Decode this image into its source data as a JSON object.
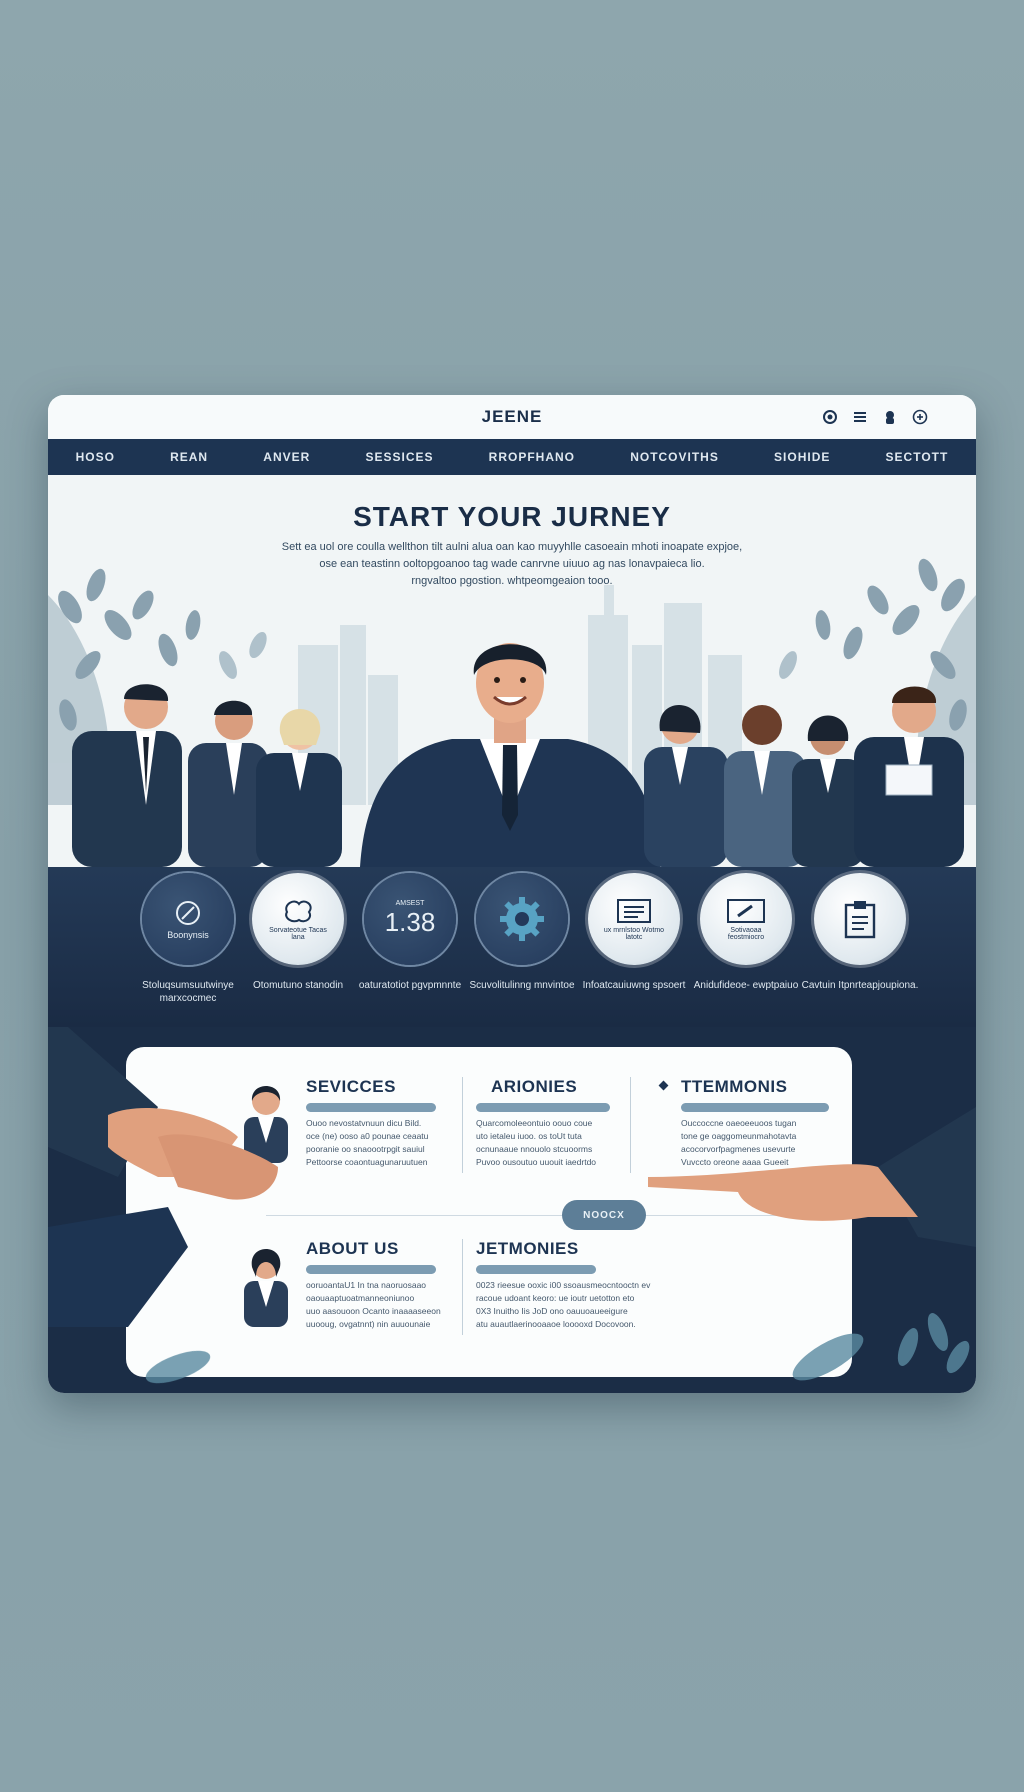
{
  "window": {
    "brand": "JEENE",
    "controls": [
      "record-icon",
      "menu-icon",
      "user-icon",
      "add-icon"
    ]
  },
  "nav": [
    "HOSO",
    "REAN",
    "ANVER",
    "SESSICES",
    "RROPFHANO",
    "NOTCOVITHS",
    "SIOHIDE",
    "SECTOTT"
  ],
  "hero": {
    "title": "START YOUR JURNEY",
    "subtitle_lines": [
      "Sett ea uol ore coulla wellthon tilt aulni alua oan kao muyyhlle casoeain mhoti inoapate expjoe,",
      "ose ean teastinn ooltopgoanoo tag wade canrvne uiuuo ag nas lonavpaieca lio.",
      "rngvaltoo pgostion.            whtpeomgeaion tooo."
    ]
  },
  "features": [
    {
      "icon": "leaf-icon",
      "circle_text": "Boonynsis",
      "label": "Stoluqsumsuutwinye marxcocmec"
    },
    {
      "icon": "brain-icon",
      "circle_text": "Sorvateotue Tacas lana",
      "label": "Otomutuno stanodin"
    },
    {
      "icon": "counter-icon",
      "circle_small": "AMSEST",
      "circle_text": "1.38",
      "label": "oaturatotiot pgvpmnnte"
    },
    {
      "icon": "gear-icon",
      "circle_text": "",
      "label": "Scuvolitulinng mnvintoe"
    },
    {
      "icon": "document-icon",
      "circle_text": "ux mrnlstoo Wotmo latotc",
      "label": "Infoatcauiuwng spsoert"
    },
    {
      "icon": "edit-icon",
      "circle_text": "Sotivaoaa feostmiocro",
      "label": "Anidufideoe- ewptpaiuo"
    },
    {
      "icon": "clipboard-icon",
      "circle_text": "",
      "label": "Cavtuin Itpnrteapjoupiona."
    }
  ],
  "sections": [
    {
      "name": "services",
      "title": "SEVICCES",
      "lines": [
        "Ouoo nevostatvnuun dicu Bild.",
        "oce (ne) ooso a0 pounae ceaatu",
        "pooranie oo snaoootrpgit sauiul",
        "Pettoorse coaontuagunaruutuen"
      ]
    },
    {
      "name": "arionies",
      "title": "ARIONIES",
      "lines": [
        "Quarcomoleeontuio oouo coue",
        "uto ietaleu iuoo. os toUt tuta",
        "ocnunaaue nnouolo stcuoorms",
        "Puvoo ousoutuo uuouit iaedrtdo"
      ]
    },
    {
      "name": "ttemmonis",
      "title": "TTEMMONIS",
      "lines": [
        "Ouccoccne oaeoeeuoos tugan",
        "tone ge oaggomeunmahotavta",
        "acocorvorfpagmenes usevurte",
        "Vuvccto oreone aaaa Gueeit"
      ]
    },
    {
      "name": "about-us",
      "title": "ABOUT US",
      "lines": [
        "ooruoantaU1 In tna naoruosaao",
        "oaouaaptuoatmanneoniunoo",
        "uuo aasouoon Ocanto inaaaaseeon",
        "uuooug, ovgatnnt) nin auuounaie"
      ]
    },
    {
      "name": "jetmonies",
      "title": "JETMONIES",
      "lines": [
        "0023 rieesue ooxic i00 ssoausmeocntooctn ev",
        "racoue udoant keoro: ue ioutr uetotton eto",
        "0X3 Inuitho Iis JoD ono oauuoaueeigure",
        "atu auautlaerinooaaoe looooxd Docovoon."
      ]
    }
  ],
  "center_pill": "NOOCX",
  "colors": {
    "navy": "#1d3452",
    "accent": "#7c9cb2",
    "background": "#8ea6ad"
  }
}
